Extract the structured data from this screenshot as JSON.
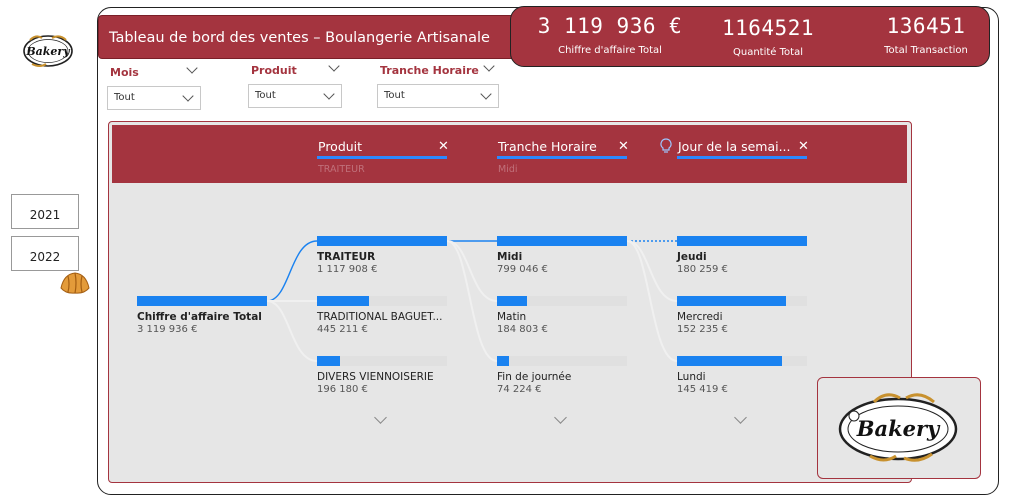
{
  "brand": {
    "logo_text": "Bakery",
    "logo_small_text": "Bakery"
  },
  "header": {
    "title": "Tableau de bord des ventes – Boulangerie Artisanale"
  },
  "kpis": [
    {
      "value": "3 119 936 €",
      "label": "Chiffre d'affaire Total"
    },
    {
      "value": "1164521",
      "label": "Quantité Total"
    },
    {
      "value": "136451",
      "label": "Total Transaction"
    }
  ],
  "filters": [
    {
      "label": "Mois",
      "value": "Tout"
    },
    {
      "label": "Produit",
      "value": "Tout"
    },
    {
      "label": "Tranche Horaire",
      "value": "Tout"
    }
  ],
  "years": [
    "2021",
    "2022"
  ],
  "tree": {
    "headers": [
      {
        "label": "Produit",
        "sub": "TRAITEUR"
      },
      {
        "label": "Tranche Horaire",
        "sub": "Midi"
      },
      {
        "label": "Jour de la semai...",
        "sub": ""
      }
    ],
    "root": {
      "name": "Chiffre d'affaire Total",
      "value": "3 119 936 €",
      "fill": 1.0
    },
    "level1": [
      {
        "name": "TRAITEUR",
        "value": "1 117 908 €",
        "fill": 1.0,
        "bold": true
      },
      {
        "name": "TRADITIONAL BAGUET...",
        "value": "445 211 €",
        "fill": 0.4,
        "bold": false
      },
      {
        "name": "DIVERS VIENNOISERIE",
        "value": "196 180 €",
        "fill": 0.18,
        "bold": false
      }
    ],
    "level2": [
      {
        "name": "Midi",
        "value": "799 046 €",
        "fill": 1.0,
        "bold": true
      },
      {
        "name": "Matin",
        "value": "184 803 €",
        "fill": 0.23,
        "bold": false
      },
      {
        "name": "Fin de journée",
        "value": "74 224 €",
        "fill": 0.09,
        "bold": false
      }
    ],
    "level3": [
      {
        "name": "Jeudi",
        "value": "180 259 €",
        "fill": 1.0,
        "bold": true
      },
      {
        "name": "Mercredi",
        "value": "152 235 €",
        "fill": 0.84,
        "bold": false
      },
      {
        "name": "Lundi",
        "value": "145 419 €",
        "fill": 0.81,
        "bold": false
      }
    ]
  },
  "colors": {
    "accent": "#a4343f",
    "bar": "#1a82f0",
    "panel_bg": "#e6e6e6"
  },
  "icons": [
    "bakery-logo",
    "croissant-icon",
    "chevron-down-icon",
    "close-icon",
    "lightbulb-icon"
  ]
}
